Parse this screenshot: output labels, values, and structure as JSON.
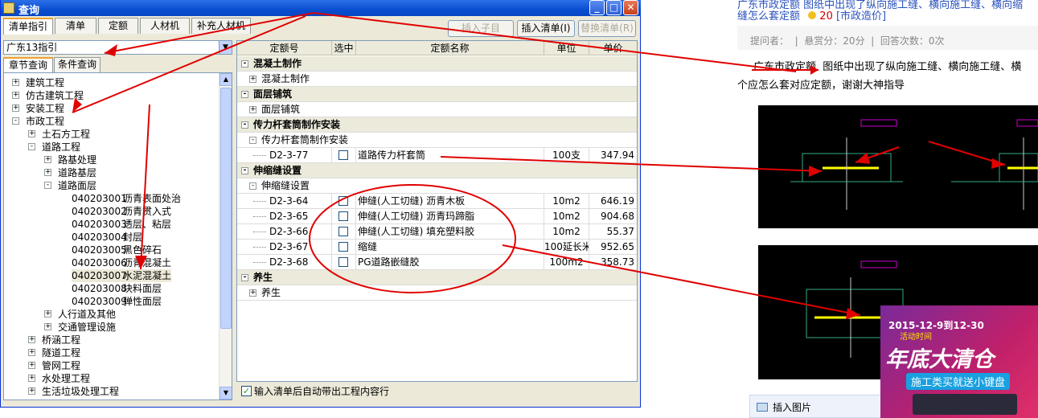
{
  "window": {
    "title": "查询"
  },
  "toolbar": {
    "tabs": [
      "清单指引",
      "清单",
      "定额",
      "人材机",
      "补充人材机"
    ],
    "insert_sub_label": "插入子目",
    "insert_list_label": "插入清单(I)",
    "replace_list_label": "替换清单(R)"
  },
  "left": {
    "combo_value": "广东13指引",
    "subtabs": [
      "章节查询",
      "条件查询"
    ],
    "tree": [
      {
        "label": "建筑工程",
        "level": 0,
        "toggle": "+"
      },
      {
        "label": "仿古建筑工程",
        "level": 0,
        "toggle": "+"
      },
      {
        "label": "安装工程",
        "level": 0,
        "toggle": "+"
      },
      {
        "label": "市政工程",
        "level": 0,
        "toggle": "-"
      },
      {
        "label": "土石方工程",
        "level": 1,
        "toggle": "+"
      },
      {
        "label": "道路工程",
        "level": 1,
        "toggle": "-"
      },
      {
        "label": "路基处理",
        "level": 2,
        "toggle": "+"
      },
      {
        "label": "道路基层",
        "level": 2,
        "toggle": "+"
      },
      {
        "label": "道路面层",
        "level": 2,
        "toggle": "-"
      },
      {
        "code": "040203001",
        "label": "沥青表面处治",
        "level": 3
      },
      {
        "code": "040203002",
        "label": "沥青贯入式",
        "level": 3
      },
      {
        "code": "040203003",
        "label": "透层、粘层",
        "level": 3
      },
      {
        "code": "040203004",
        "label": "封层",
        "level": 3
      },
      {
        "code": "040203005",
        "label": "黑色碎石",
        "level": 3
      },
      {
        "code": "040203006",
        "label": "沥青混凝土",
        "level": 3
      },
      {
        "code": "040203007",
        "label": "水泥混凝土",
        "level": 3,
        "selected": true
      },
      {
        "code": "040203008",
        "label": "块料面层",
        "level": 3
      },
      {
        "code": "040203009",
        "label": "弹性面层",
        "level": 3
      },
      {
        "label": "人行道及其他",
        "level": 2,
        "toggle": "+"
      },
      {
        "label": "交通管理设施",
        "level": 2,
        "toggle": "+"
      },
      {
        "label": "桥涵工程",
        "level": 1,
        "toggle": "+"
      },
      {
        "label": "隧道工程",
        "level": 1,
        "toggle": "+"
      },
      {
        "label": "管网工程",
        "level": 1,
        "toggle": "+"
      },
      {
        "label": "水处理工程",
        "level": 1,
        "toggle": "+"
      },
      {
        "label": "生活垃圾处理工程",
        "level": 1,
        "toggle": "+"
      }
    ]
  },
  "grid": {
    "headers": [
      "定额号",
      "选中",
      "定额名称",
      "单位",
      "单价"
    ],
    "rows": [
      {
        "type": "group",
        "toggle": "-",
        "name": "混凝土制作"
      },
      {
        "type": "sub",
        "toggle": "+",
        "name": "混凝土制作"
      },
      {
        "type": "group",
        "toggle": "-",
        "name": "面层铺筑"
      },
      {
        "type": "sub",
        "toggle": "+",
        "name": "面层铺筑"
      },
      {
        "type": "group",
        "toggle": "-",
        "name": "传力杆套筒制作安装"
      },
      {
        "type": "sub",
        "toggle": "-",
        "name": "传力杆套筒制作安装"
      },
      {
        "type": "item",
        "code": "D2-3-77",
        "name": "道路传力杆套筒",
        "unit": "100支",
        "price": "347.94"
      },
      {
        "type": "group",
        "toggle": "-",
        "name": "伸缩缝设置"
      },
      {
        "type": "sub",
        "toggle": "-",
        "name": "伸缩缝设置"
      },
      {
        "type": "item",
        "code": "D2-3-64",
        "name": "伸缝(人工切缝) 沥青木板",
        "unit": "10m2",
        "price": "646.19"
      },
      {
        "type": "item",
        "code": "D2-3-65",
        "name": "伸缝(人工切缝) 沥青玛蹄脂",
        "unit": "10m2",
        "price": "904.68"
      },
      {
        "type": "item",
        "code": "D2-3-66",
        "name": "伸缝(人工切缝) 填充塑料胶",
        "unit": "10m2",
        "price": "55.37"
      },
      {
        "type": "item",
        "code": "D2-3-67",
        "name": "缩缝",
        "unit": "100延长米",
        "price": "952.65"
      },
      {
        "type": "item",
        "code": "D2-3-68",
        "name": "PG道路嵌缝胶",
        "unit": "100m2",
        "price": "358.73"
      },
      {
        "type": "group",
        "toggle": "-",
        "name": "养生"
      },
      {
        "type": "sub",
        "toggle": "+",
        "name": "养生"
      }
    ],
    "footer_label": "输入清单后自动带出工程内容行"
  },
  "webpage": {
    "title_line1": "广东市政定额 图纸中出现了纵向施工缝、横向施工缝、横向缩",
    "title_line2": "缝怎么套定额",
    "coins": "20",
    "category": "[市政造价]",
    "meta": "提问者：  |  悬赏分：20分  |  回答次数：0次",
    "body_line1": "广东市政定额  图纸中出现了纵向施工缝、横向施工缝、横",
    "body_line2": "个应怎么套对应定额，谢谢大神指导",
    "insert_image_label": "插入图片",
    "ad_date": "2015-12-9到12-30",
    "ad_sub": "活动时间",
    "ad_title": "年底大清仓",
    "ad_slogan": "施工类买就送小键盘"
  }
}
